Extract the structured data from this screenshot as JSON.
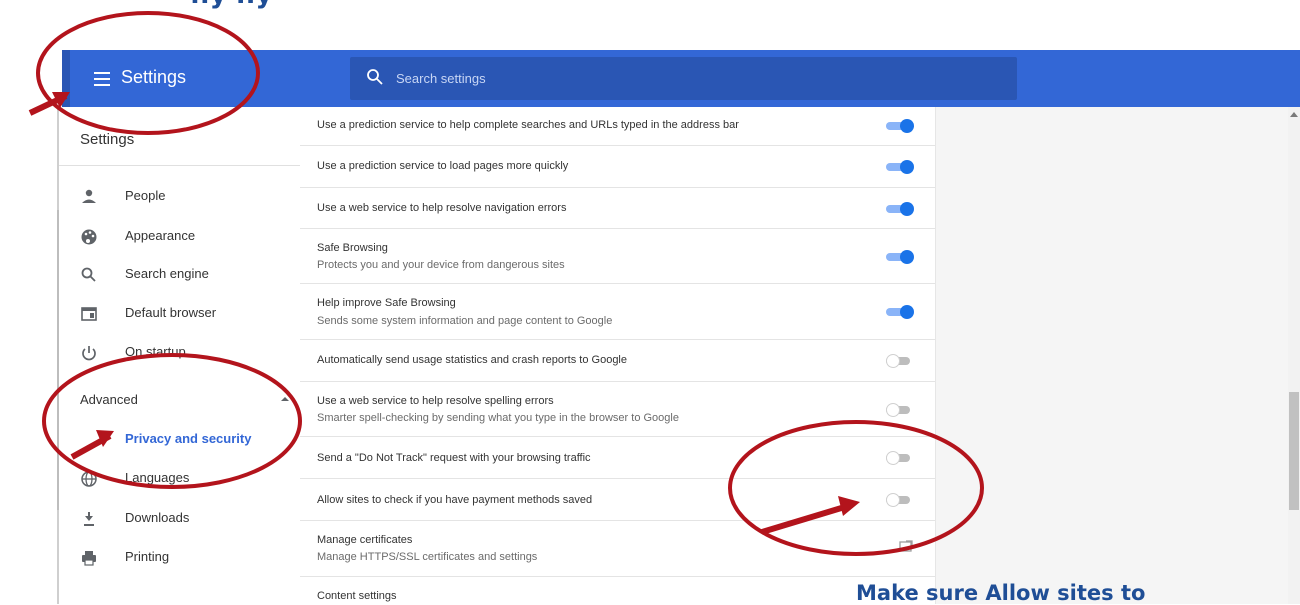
{
  "header": {
    "title": "Settings",
    "search_placeholder": "Search settings"
  },
  "sidebar": {
    "title": "Settings",
    "items": [
      {
        "label": "People",
        "icon": "person-icon"
      },
      {
        "label": "Appearance",
        "icon": "palette-icon"
      },
      {
        "label": "Search engine",
        "icon": "search-icon"
      },
      {
        "label": "Default browser",
        "icon": "browser-window-icon"
      },
      {
        "label": "On startup",
        "icon": "power-icon"
      }
    ],
    "advanced_label": "Advanced",
    "advanced_items": [
      {
        "label": "Privacy and security",
        "selected": true
      },
      {
        "label": "Languages",
        "icon": "globe-icon"
      },
      {
        "label": "Downloads",
        "icon": "download-icon"
      },
      {
        "label": "Printing",
        "icon": "printer-icon"
      }
    ]
  },
  "settings_rows": [
    {
      "title": "Use a prediction service to help complete searches and URLs typed in the address bar",
      "enabled": true
    },
    {
      "title": "Use a prediction service to load pages more quickly",
      "enabled": true
    },
    {
      "title": "Use a web service to help resolve navigation errors",
      "enabled": true
    },
    {
      "title": "Safe Browsing",
      "subtitle": "Protects you and your device from dangerous sites",
      "enabled": true
    },
    {
      "title": "Help improve Safe Browsing",
      "subtitle": "Sends some system information and page content to Google",
      "enabled": true
    },
    {
      "title": "Automatically send usage statistics and crash reports to Google",
      "enabled": false
    },
    {
      "title": "Use a web service to help resolve spelling errors",
      "subtitle": "Smarter spell-checking by sending what you type in the browser to Google",
      "enabled": false
    },
    {
      "title": "Send a \"Do Not Track\" request with your browsing traffic",
      "enabled": false
    },
    {
      "title": "Allow sites to check if you have payment methods saved",
      "enabled": false
    },
    {
      "title": "Manage certificates",
      "subtitle": "Manage HTTPS/SSL certificates and settings"
    },
    {
      "title": "Content settings"
    }
  ],
  "annotation": {
    "note": "Make sure Allow sites to",
    "color": "#b3141c"
  },
  "colors": {
    "header_blue": "#3367d6",
    "toggle_on": "#1a73e8",
    "selected_text": "#3367d6"
  }
}
